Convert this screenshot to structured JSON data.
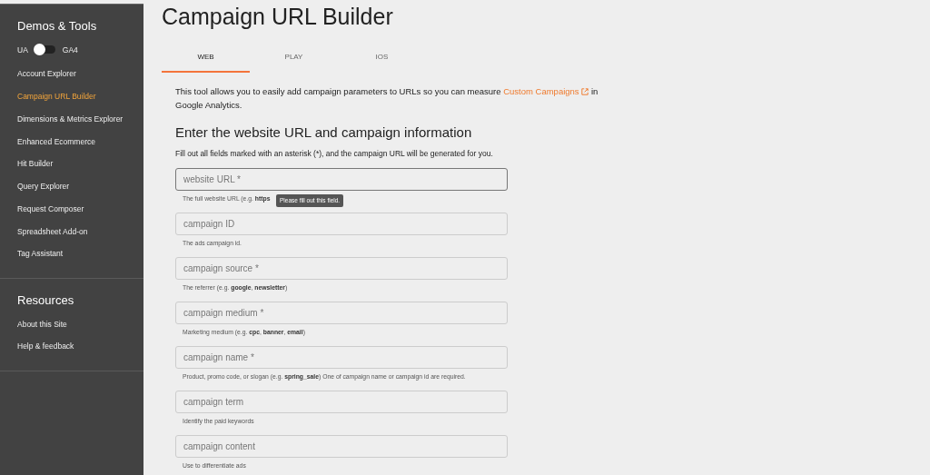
{
  "sidebar": {
    "sections": [
      {
        "title": "Demos & Tools",
        "toggle": {
          "left_label": "UA",
          "right_label": "GA4",
          "on": false
        },
        "items": [
          {
            "label": "Account Explorer",
            "selected": false
          },
          {
            "label": "Campaign URL Builder",
            "selected": true
          },
          {
            "label": "Dimensions & Metrics Explorer",
            "selected": false
          },
          {
            "label": "Enhanced Ecommerce",
            "selected": false
          },
          {
            "label": "Hit Builder",
            "selected": false
          },
          {
            "label": "Query Explorer",
            "selected": false
          },
          {
            "label": "Request Composer",
            "selected": false
          },
          {
            "label": "Spreadsheet Add-on",
            "selected": false
          },
          {
            "label": "Tag Assistant",
            "selected": false
          }
        ]
      },
      {
        "title": "Resources",
        "items": [
          {
            "label": "About this Site",
            "selected": false
          },
          {
            "label": "Help & feedback",
            "selected": false
          }
        ]
      }
    ]
  },
  "page_title": "Campaign URL Builder",
  "tabs": [
    {
      "label": "WEB",
      "selected": true
    },
    {
      "label": "PLAY",
      "selected": false
    },
    {
      "label": "IOS",
      "selected": false
    }
  ],
  "intro": {
    "before": "This tool allows you to easily add campaign parameters to URLs so you can measure",
    "link": "Custom Campaigns",
    "after": "in Google Analytics."
  },
  "heading": "Enter the website URL and campaign information",
  "instruction": "Fill out all fields marked with an asterisk (*), and the campaign URL will be generated for you.",
  "fields": [
    {
      "placeholder": "website URL *",
      "helper": "The full website URL (e.g. **https**",
      "focused": true,
      "tooltip": "Please fill out this field."
    },
    {
      "placeholder": "campaign ID",
      "helper": "The ads campaign id.",
      "focused": false
    },
    {
      "placeholder": "campaign source *",
      "helper": "The referrer (e.g. **google**, **newsletter**)",
      "focused": false
    },
    {
      "placeholder": "campaign medium *",
      "helper": "Marketing medium (e.g. **cpc**, **banner**, **email**)",
      "focused": false
    },
    {
      "placeholder": "campaign name *",
      "helper": "Product, promo code, or slogan (e.g. **spring_sale**) One of campaign name or campaign id are required.",
      "focused": false
    },
    {
      "placeholder": "campaign term",
      "helper": "Identify the paid keywords",
      "focused": false
    },
    {
      "placeholder": "campaign content",
      "helper": "Use to differentiate ads",
      "focused": false
    }
  ]
}
